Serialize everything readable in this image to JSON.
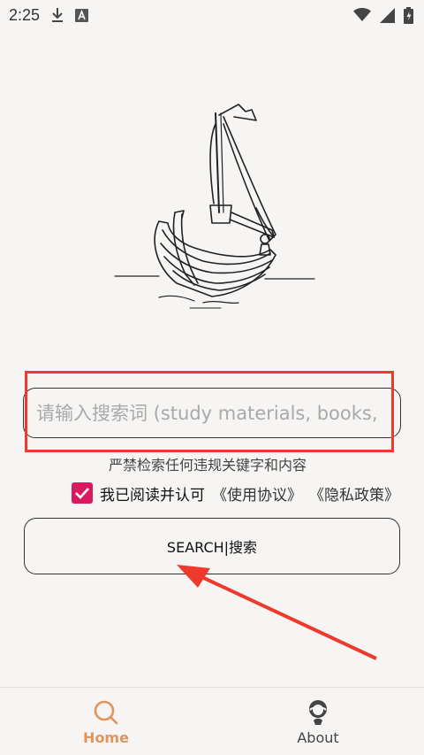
{
  "status_bar": {
    "time": "2:25",
    "icons": [
      "download-icon",
      "notification-a-icon",
      "wifi-icon",
      "signal-icon",
      "battery-charging-icon"
    ]
  },
  "search": {
    "placeholder": "请输入搜索词 (study materials, books,",
    "value": ""
  },
  "warning_text": "严禁检索任何违规关键字和内容",
  "agreement": {
    "checked": true,
    "text": "我已阅读并认可",
    "terms_link": "《使用协议》",
    "privacy_link": "《隐私政策》"
  },
  "search_button_label": "SEARCH|搜索",
  "bottom_nav": {
    "items": [
      {
        "label": "Home",
        "icon": "search-icon",
        "active": true
      },
      {
        "label": "About",
        "icon": "avatar-icon",
        "active": false
      }
    ]
  },
  "colors": {
    "accent": "#e0945e",
    "checkbox": "#d81b60",
    "annotation_red": "#ee3a2c",
    "background": "#f6f5f4"
  }
}
